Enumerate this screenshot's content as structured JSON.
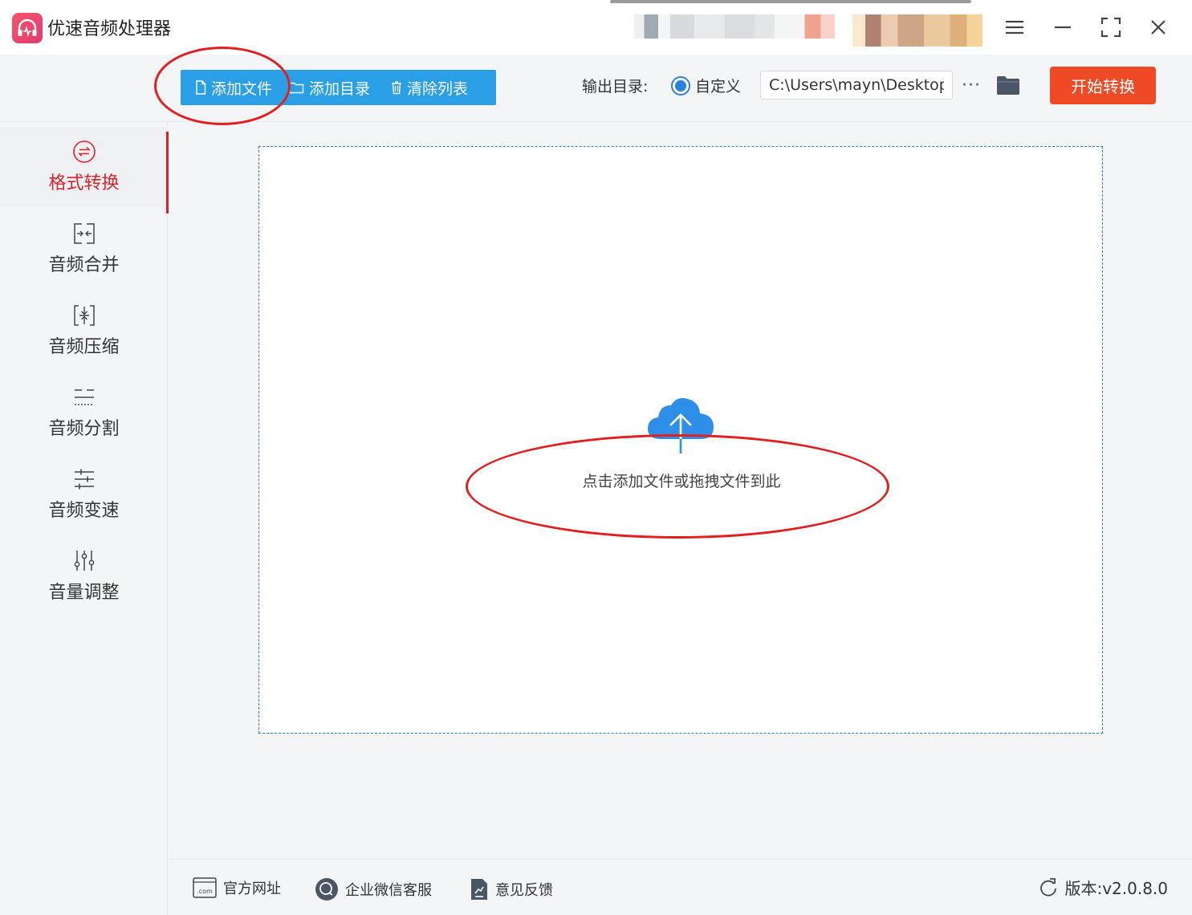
{
  "app": {
    "title": "优速音频处理器"
  },
  "toolbar": {
    "add_file": "添加文件",
    "add_folder": "添加目录",
    "clear_list": "清除列表",
    "output_label": "输出目录:",
    "custom_option": "自定义",
    "output_path": "C:\\Users\\mayn\\Desktop",
    "more": "···",
    "start": "开始转换"
  },
  "sidebar": {
    "items": [
      {
        "label": "格式转换",
        "icon": "format-convert-icon",
        "active": true
      },
      {
        "label": "音频合并",
        "icon": "merge-icon",
        "active": false
      },
      {
        "label": "音频压缩",
        "icon": "compress-icon",
        "active": false
      },
      {
        "label": "音频分割",
        "icon": "split-icon",
        "active": false
      },
      {
        "label": "音频变速",
        "icon": "speed-icon",
        "active": false
      },
      {
        "label": "音量调整",
        "icon": "volume-adjust-icon",
        "active": false
      }
    ]
  },
  "dropzone": {
    "hint": "点击添加文件或拖拽文件到此"
  },
  "footer": {
    "website": "官方网址",
    "wechat": "企业微信客服",
    "feedback": "意见反馈",
    "version": "版本:v2.0.8.0"
  },
  "colors": {
    "accent_blue": "#2a9fe6",
    "start_red": "#ef4a26",
    "active_red": "#d9232b",
    "annotation_red": "#e02020"
  }
}
